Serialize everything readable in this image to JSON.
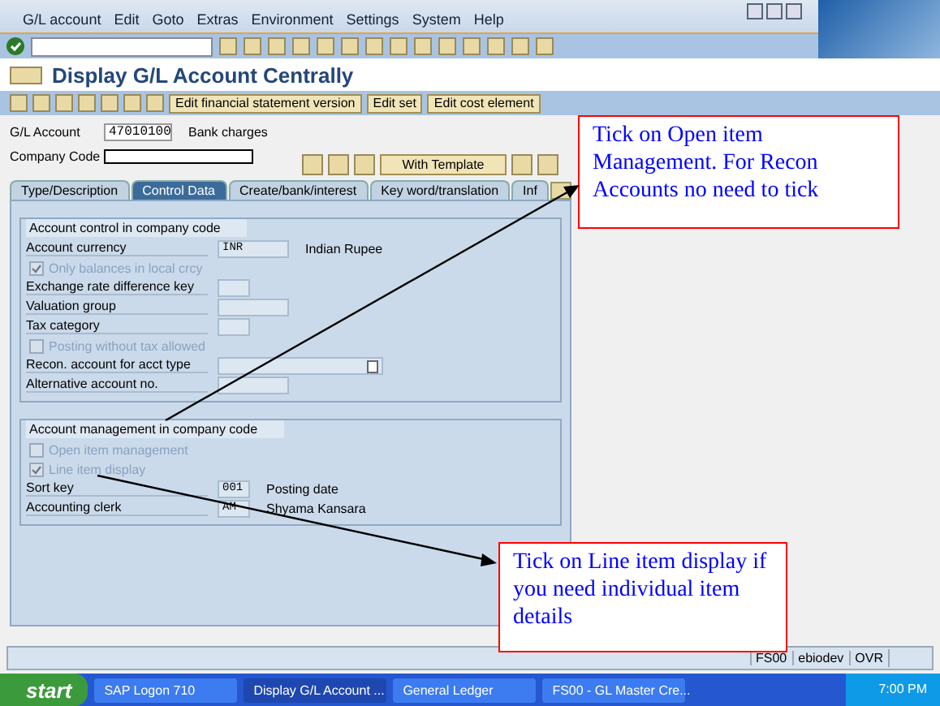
{
  "menu": [
    "G/L account",
    "Edit",
    "Goto",
    "Extras",
    "Environment",
    "Settings",
    "System",
    "Help"
  ],
  "title": "Display G/L Account Centrally",
  "app_buttons": [
    "Edit financial statement version",
    "Edit set",
    "Edit cost element"
  ],
  "header": {
    "gl_account_label": "G/L Account",
    "gl_account": "47010100",
    "gl_account_name": "Bank charges",
    "company_code_label": "Company Code",
    "template_button": "With Template"
  },
  "tabs": [
    {
      "label": "Type/Description",
      "selected": false
    },
    {
      "label": "Control Data",
      "selected": true
    },
    {
      "label": "Create/bank/interest",
      "selected": false
    },
    {
      "label": "Key word/translation",
      "selected": false
    },
    {
      "label": "Inf",
      "selected": false
    }
  ],
  "groups": [
    {
      "title": "Account control in company code",
      "rows": [
        {
          "kind": "field",
          "label": "Account currency",
          "value": "INR",
          "note": "Indian Rupee"
        },
        {
          "kind": "checkbox",
          "label": "Only balances in local crcy",
          "checked": true,
          "disabled": true
        },
        {
          "kind": "short",
          "label": "Exchange rate difference key"
        },
        {
          "kind": "field",
          "label": "Valuation group"
        },
        {
          "kind": "short",
          "label": "Tax category"
        },
        {
          "kind": "checkbox",
          "label": "Posting without tax allowed",
          "checked": false,
          "disabled": true
        },
        {
          "kind": "dropdown",
          "label": "Recon. account for acct type"
        },
        {
          "kind": "field",
          "label": "Alternative account no."
        }
      ]
    },
    {
      "title": "Account management in company code",
      "rows": [
        {
          "kind": "checkbox",
          "label": "Open item management",
          "checked": false,
          "disabled": true
        },
        {
          "kind": "checkbox",
          "label": "Line item display",
          "checked": true,
          "disabled": true
        },
        {
          "kind": "short",
          "label": "Sort key",
          "value": "001",
          "note": "Posting date"
        },
        {
          "kind": "short",
          "label": "Accounting clerk",
          "value": "AM",
          "note": "Shyama Kansara"
        }
      ]
    }
  ],
  "callouts": [
    "Tick on Open item Management. For Recon Accounts no need to tick",
    "Tick on Line item display if you need individual item details"
  ],
  "status_bar": {
    "transaction": "FS00",
    "system": "ebiodev",
    "mode": "OVR"
  },
  "taskbar": {
    "start": "start",
    "items": [
      {
        "label": "SAP Logon 710",
        "selected": false
      },
      {
        "label": "Display G/L Account ...",
        "selected": true
      },
      {
        "label": "General Ledger",
        "selected": false
      },
      {
        "label": "FS00 - GL Master Cre...",
        "selected": false
      }
    ],
    "clock": "7:00 PM"
  }
}
